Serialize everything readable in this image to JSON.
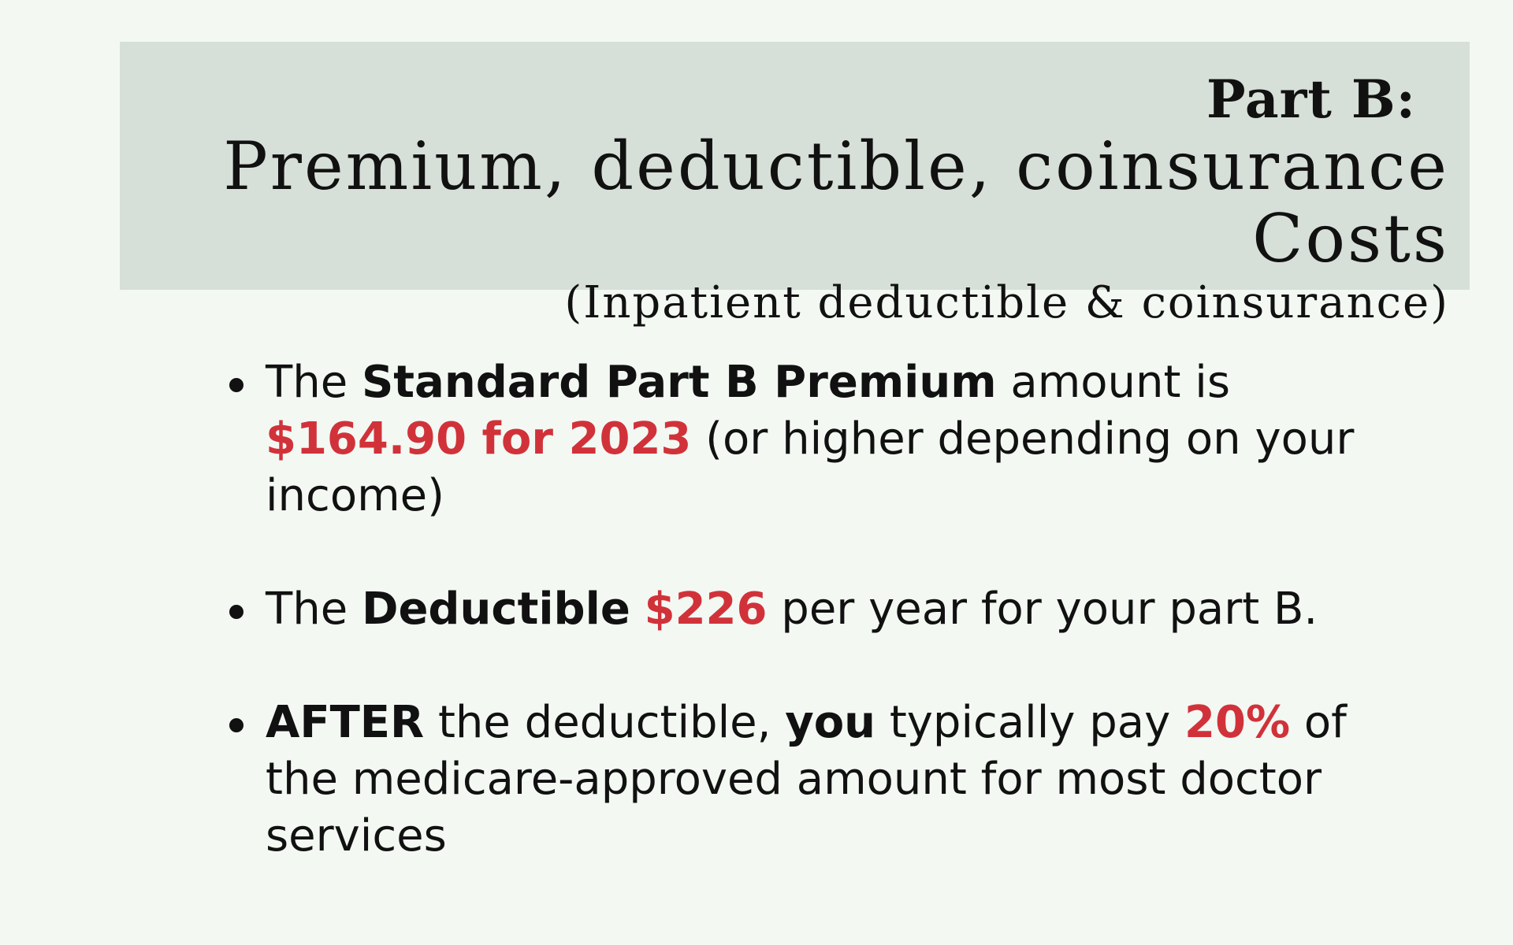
{
  "colors": {
    "background": "#f3f8f3",
    "header_bg": "#d7e0d8",
    "text": "#111111",
    "accent_red": "#d1323a"
  },
  "header": {
    "line1": "Part B:",
    "line2": "Premium, deductible, coinsurance Costs",
    "line3": "(Inpatient deductible & coinsurance)"
  },
  "bullets": [
    {
      "segments": [
        {
          "text": "The ",
          "style": "normal"
        },
        {
          "text": "Standard Part B Premium",
          "style": "bold"
        },
        {
          "text": " amount is ",
          "style": "normal"
        },
        {
          "text": "$164.90 for 2023",
          "style": "accent"
        },
        {
          "text": " (or higher depending on your income)",
          "style": "normal"
        }
      ]
    },
    {
      "segments": [
        {
          "text": "The ",
          "style": "normal"
        },
        {
          "text": "Deductible",
          "style": "bold"
        },
        {
          "text": " ",
          "style": "normal"
        },
        {
          "text": "$226",
          "style": "accent"
        },
        {
          "text": " per year for your part B.",
          "style": "normal"
        }
      ]
    },
    {
      "segments": [
        {
          "text": "AFTER",
          "style": "bold"
        },
        {
          "text": " the deductible, ",
          "style": "normal"
        },
        {
          "text": "you",
          "style": "bold"
        },
        {
          "text": " typically pay ",
          "style": "normal"
        },
        {
          "text": "20%",
          "style": "accent"
        },
        {
          "text": " of the medicare-approved amount for most doctor services",
          "style": "normal"
        }
      ]
    }
  ]
}
